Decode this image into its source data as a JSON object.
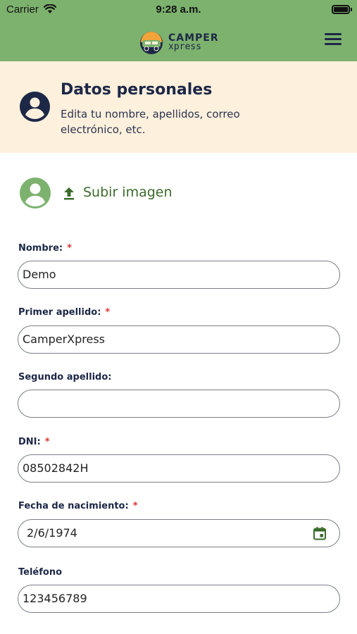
{
  "status": {
    "carrier": "Carrier",
    "time": "9:28 a.m."
  },
  "header": {
    "logo_top": "CAMPER",
    "logo_bottom": "xpress",
    "menu_icon": "hamburger-menu-icon"
  },
  "section": {
    "title": "Datos personales",
    "description": "Edita tu nombre, apellidos, correo electrónico, etc.",
    "icon": "account-circle-icon"
  },
  "upload": {
    "label": "Subir imagen",
    "icon": "upload-icon"
  },
  "form": {
    "fields": [
      {
        "label": "Nombre:",
        "required": "*",
        "value": "Demo"
      },
      {
        "label": "Primer apellido:",
        "required": "*",
        "value": "CamperXpress"
      },
      {
        "label": "Segundo apellido:",
        "value": ""
      },
      {
        "label": "DNI:",
        "required": "*",
        "value": "08502842H"
      },
      {
        "label": "Fecha de nacimiento:",
        "required": "*",
        "value": "2/6/1974"
      },
      {
        "label": "Teléfono",
        "value": "123456789"
      }
    ]
  },
  "colors": {
    "header_bg": "#7db26e",
    "section_bg": "#fdf0dc",
    "primary": "#1d2847",
    "accent_green": "#3b6b2c",
    "required": "#dd3333"
  }
}
